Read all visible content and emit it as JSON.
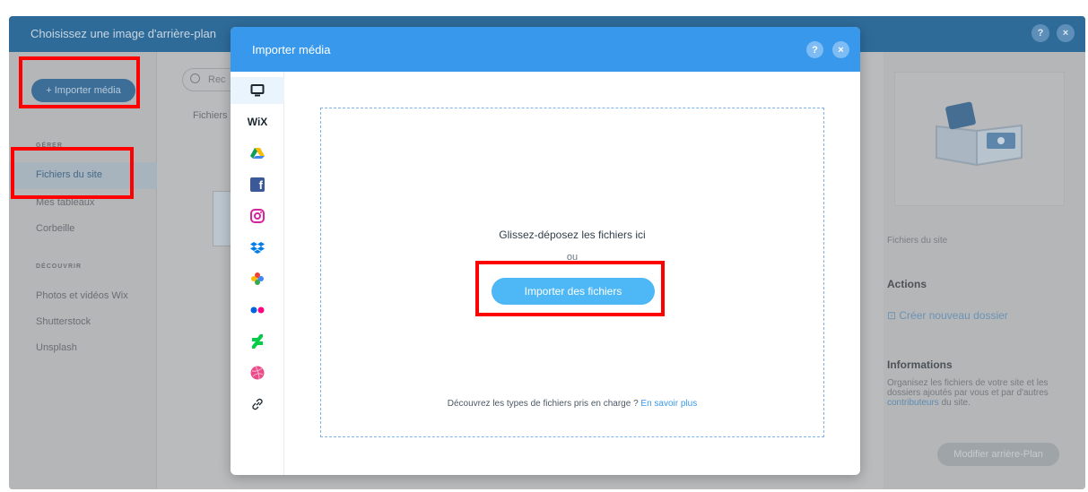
{
  "background_dialog": {
    "title": "Choisissez une image d'arrière-plan",
    "help_symbol": "?",
    "close_symbol": "×",
    "import_media_label": "+ Importer média",
    "search_placeholder": "Rec",
    "files_tab_label": "Fichiers",
    "section_manage": "GÉRER",
    "section_discover": "DÉCOUVRIR",
    "nav_site_files": "Fichiers du site",
    "nav_my_boards": "Mes tableaux",
    "nav_trash": "Corbeille",
    "nav_wix_media": "Photos et vidéos Wix",
    "nav_shutterstock": "Shutterstock",
    "nav_unsplash": "Unsplash",
    "right_site_files": "Fichiers du site",
    "actions_title": "Actions",
    "create_folder": "Créer nouveau dossier",
    "info_title": "Informations",
    "info_text_1": "Organisez les fichiers de votre site et les dossiers ajoutés par vous et par d'autres ",
    "info_link": "contributeurs",
    "info_text_2": " du site.",
    "modify_button": "Modifier arrière-Plan"
  },
  "modal": {
    "title": "Importer média",
    "help_symbol": "?",
    "close_symbol": "×",
    "sources": [
      "computer-icon",
      "wix-icon",
      "google-drive-icon",
      "facebook-icon",
      "instagram-icon",
      "dropbox-icon",
      "google-photos-icon",
      "flickr-icon",
      "deviantart-icon",
      "dribbble-icon",
      "link-icon"
    ],
    "wix_logo_text": "WiX",
    "facebook_glyph": "f",
    "drop_text": "Glissez-déposez les fichiers ici",
    "or_text": "ou",
    "import_button": "Importer des fichiers",
    "footer_text": "Découvrez les types de fichiers pris en charge ? ",
    "footer_link": "En savoir plus"
  },
  "colors": {
    "accent": "#3899ec",
    "button": "#4eb7f5",
    "highlight": "#ff0000"
  }
}
